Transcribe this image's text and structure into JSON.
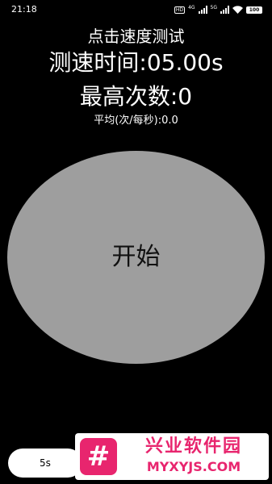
{
  "status_bar": {
    "time": "21:18",
    "hd_badge": "HD",
    "network_4g": "4G",
    "network_5g": "5G",
    "battery": "100"
  },
  "title": "点击速度测试",
  "timer_text": "测速时间:05.00s",
  "max_count_text": "最高次数:0",
  "average_text": "平均(次/每秒):0.0",
  "start_button_label": "开始",
  "duration_select_value": "5s",
  "watermark": {
    "name": "兴业软件园",
    "url": "MYXYJS.COM"
  },
  "colors": {
    "background": "#000000",
    "button": "#9e9e9e",
    "watermark_accent": "#e8256e"
  }
}
